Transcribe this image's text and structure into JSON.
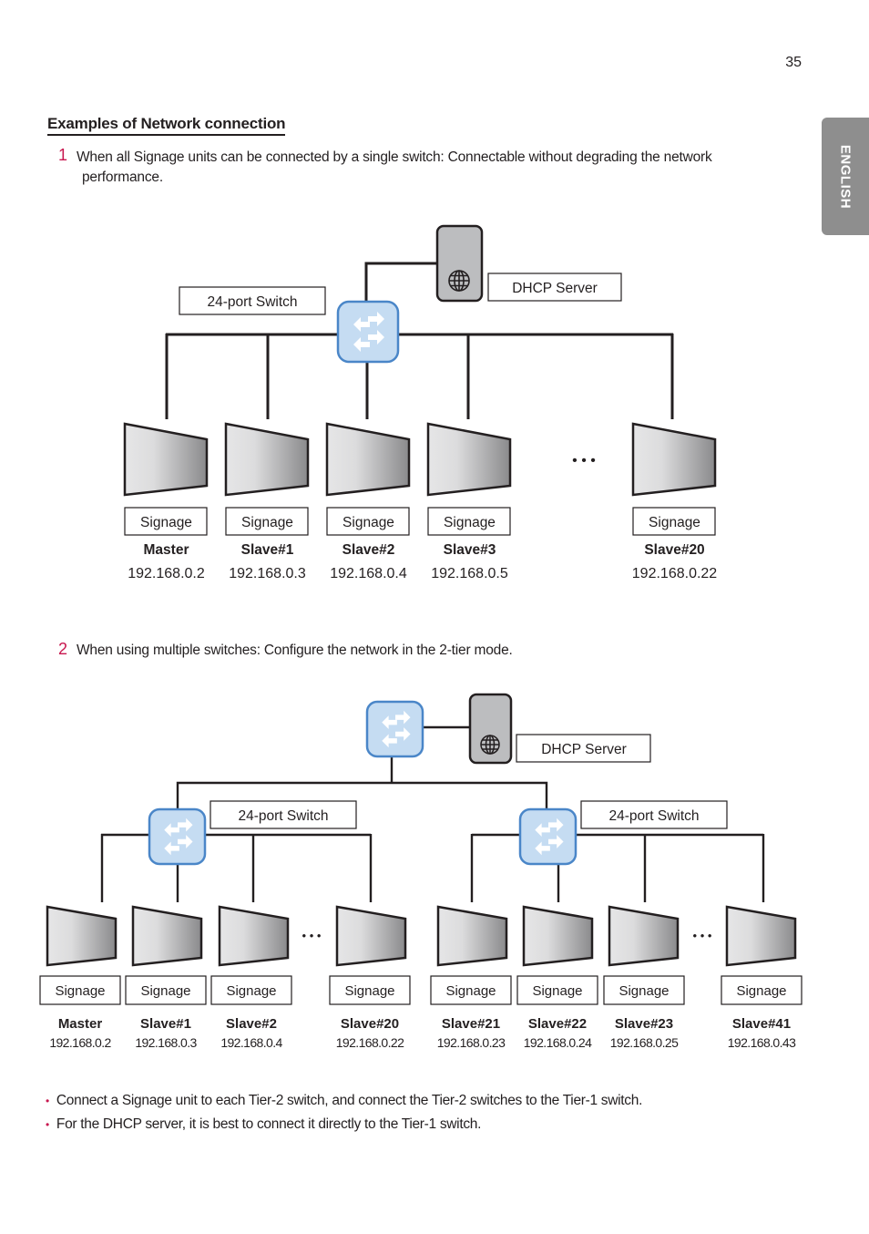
{
  "page_number": "35",
  "language_tab": "ENGLISH",
  "heading": "Examples of Network connection",
  "step1": {
    "number": "1",
    "line1": "When all Signage units can be connected by a single switch: Connectable without degrading the network",
    "line2": "performance."
  },
  "step2": {
    "number": "2",
    "text": "When using multiple switches: Configure the network in the 2-tier mode."
  },
  "diagram1": {
    "switch_label": "24-port Switch",
    "server_label": "DHCP Server",
    "ellipsis": "• • •",
    "devices": [
      {
        "box": "Signage",
        "name": "Master",
        "ip": "192.168.0.2"
      },
      {
        "box": "Signage",
        "name": "Slave#1",
        "ip": "192.168.0.3"
      },
      {
        "box": "Signage",
        "name": "Slave#2",
        "ip": "192.168.0.4"
      },
      {
        "box": "Signage",
        "name": "Slave#3",
        "ip": "192.168.0.5"
      },
      {
        "box": "Signage",
        "name": "Slave#20",
        "ip": "192.168.0.22"
      }
    ]
  },
  "diagram2": {
    "server_label": "DHCP Server",
    "left_switch_label": "24-port Switch",
    "right_switch_label": "24-port Switch",
    "ellipsis": "• • •",
    "devices": [
      {
        "box": "Signage",
        "name": "Master",
        "ip": "192.168.0.2"
      },
      {
        "box": "Signage",
        "name": "Slave#1",
        "ip": "192.168.0.3"
      },
      {
        "box": "Signage",
        "name": "Slave#2",
        "ip": "192.168.0.4"
      },
      {
        "box": "Signage",
        "name": "Slave#20",
        "ip": "192.168.0.22"
      },
      {
        "box": "Signage",
        "name": "Slave#21",
        "ip": "192.168.0.23"
      },
      {
        "box": "Signage",
        "name": "Slave#22",
        "ip": "192.168.0.24"
      },
      {
        "box": "Signage",
        "name": "Slave#23",
        "ip": "192.168.0.25"
      },
      {
        "box": "Signage",
        "name": "Slave#41",
        "ip": "192.168.0.43"
      }
    ]
  },
  "bullets": [
    "Connect a Signage unit to each Tier-2 switch, and connect the Tier-2 switches to the Tier-1 switch.",
    "For the DHCP server, it is best to connect it directly to the Tier-1 switch."
  ],
  "colors": {
    "accent": "#c8174f",
    "switch_fill": "#c5dcf2",
    "switch_stroke": "#4a86c8",
    "server_fill": "#bcbdbf",
    "tab_gray": "#8e8e8e"
  }
}
